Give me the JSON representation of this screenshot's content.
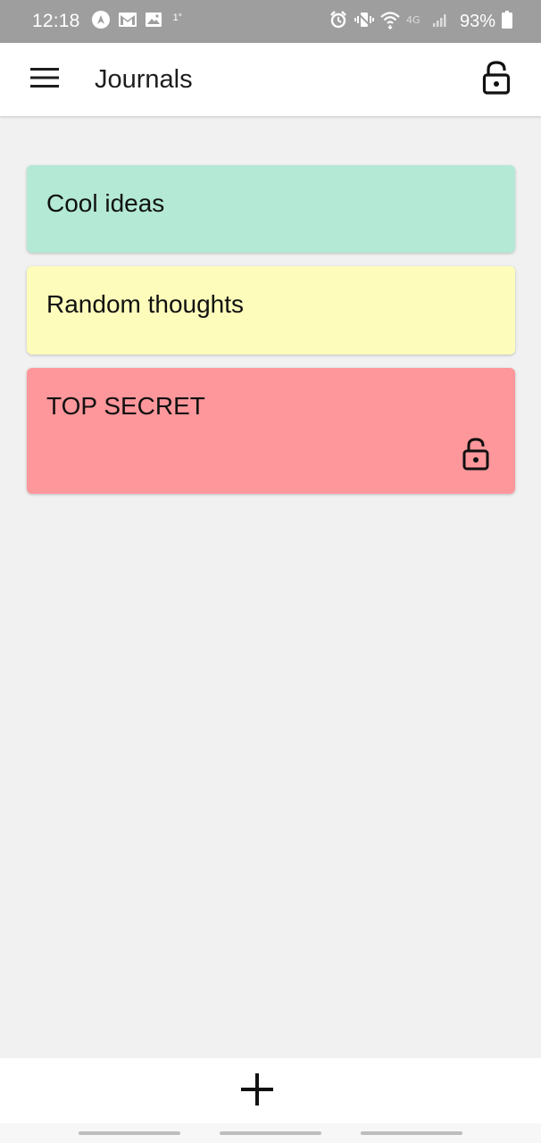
{
  "status_bar": {
    "time": "12:18",
    "small_text": "1°",
    "battery_percent": "93%",
    "icons": [
      "nav-app-icon",
      "gmail-icon",
      "gallery-icon",
      "alarm-icon",
      "vibrate-icon",
      "wifi-icon",
      "4g-icon",
      "signal-icon",
      "battery-icon"
    ]
  },
  "app_bar": {
    "title": "Journals",
    "menu_icon": "hamburger-menu-icon",
    "lock_icon": "lock-open-icon"
  },
  "journals": [
    {
      "title": "Cool ideas",
      "color": "#b3e9d5",
      "locked": false
    },
    {
      "title": "Random thoughts",
      "color": "#fefcbb",
      "locked": false
    },
    {
      "title": "TOP SECRET",
      "color": "#fe979b",
      "locked": true
    }
  ],
  "bottom_bar": {
    "add_icon": "plus-icon"
  }
}
